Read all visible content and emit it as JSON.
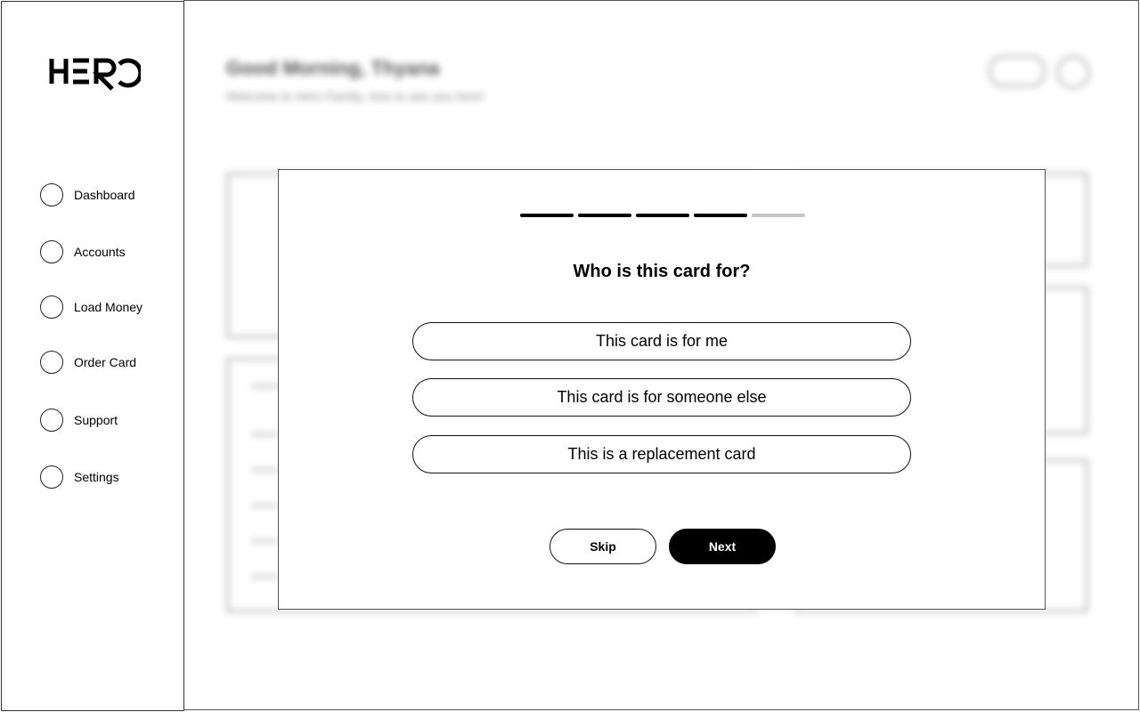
{
  "brand": {
    "logo_text": "HERO"
  },
  "sidebar": {
    "items": [
      {
        "label": "Dashboard",
        "icon": "dashboard-icon"
      },
      {
        "label": "Accounts",
        "icon": "accounts-icon"
      },
      {
        "label": "Load Money",
        "icon": "load-money-icon"
      },
      {
        "label": "Order Card",
        "icon": "order-card-icon"
      },
      {
        "label": "Support",
        "icon": "support-icon"
      },
      {
        "label": "Settings",
        "icon": "settings-icon"
      }
    ]
  },
  "header": {
    "greeting": "Good Morning, Thyana",
    "subgreeting": "Welcome to Hero Family, nice to see you here!"
  },
  "modal": {
    "progress": {
      "total_steps": 5,
      "current_step": 4
    },
    "title": "Who is this card for?",
    "options": [
      "This card is for me",
      "This card is for someone else",
      "This is a replacement card"
    ],
    "skip_label": "Skip",
    "next_label": "Next"
  },
  "colors": {
    "primary": "#000000",
    "progress_inactive": "#c6c6c6",
    "background": "#ffffff"
  }
}
